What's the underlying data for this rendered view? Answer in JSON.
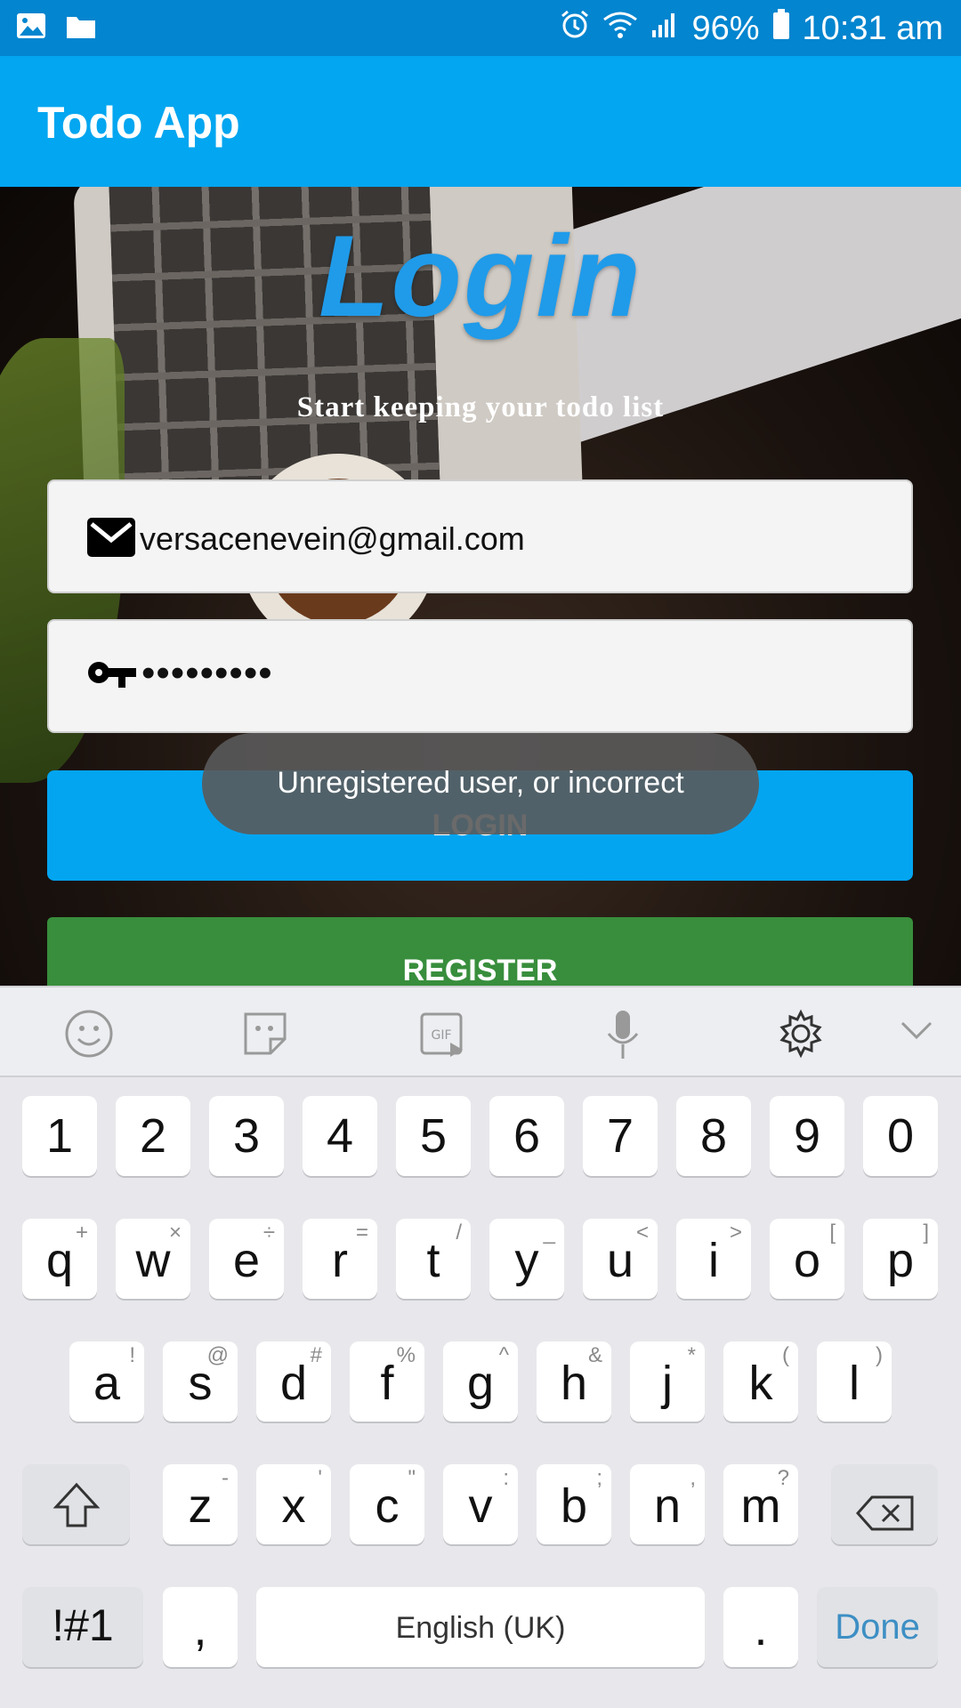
{
  "status_bar": {
    "battery": "96%",
    "time": "10:31 am"
  },
  "app_bar": {
    "title": "Todo App"
  },
  "login": {
    "heading": "Login",
    "subtitle": "Start keeping your todo list",
    "email_value": "versacenevein@gmail.com",
    "password_mask": "•••••••••",
    "login_button": "LOGIN",
    "register_button": "REGISTER"
  },
  "toast": {
    "message": "Unregistered user, or incorrect"
  },
  "keyboard": {
    "number_row": [
      "1",
      "2",
      "3",
      "4",
      "5",
      "6",
      "7",
      "8",
      "9",
      "0"
    ],
    "row1": [
      {
        "k": "q",
        "alt": "+"
      },
      {
        "k": "w",
        "alt": "×"
      },
      {
        "k": "e",
        "alt": "÷"
      },
      {
        "k": "r",
        "alt": "="
      },
      {
        "k": "t",
        "alt": "/"
      },
      {
        "k": "y",
        "alt": "_"
      },
      {
        "k": "u",
        "alt": "<"
      },
      {
        "k": "i",
        "alt": ">"
      },
      {
        "k": "o",
        "alt": "["
      },
      {
        "k": "p",
        "alt": "]"
      }
    ],
    "row2": [
      {
        "k": "a",
        "alt": "!"
      },
      {
        "k": "s",
        "alt": "@"
      },
      {
        "k": "d",
        "alt": "#"
      },
      {
        "k": "f",
        "alt": "%"
      },
      {
        "k": "g",
        "alt": "^"
      },
      {
        "k": "h",
        "alt": "&"
      },
      {
        "k": "j",
        "alt": "*"
      },
      {
        "k": "k",
        "alt": "("
      },
      {
        "k": "l",
        "alt": ")"
      }
    ],
    "row3": [
      {
        "k": "z",
        "alt": "-"
      },
      {
        "k": "x",
        "alt": "'"
      },
      {
        "k": "c",
        "alt": "\""
      },
      {
        "k": "v",
        "alt": ":"
      },
      {
        "k": "b",
        "alt": ";"
      },
      {
        "k": "n",
        "alt": ","
      },
      {
        "k": "m",
        "alt": "?"
      }
    ],
    "symbols_key": "!#1",
    "comma_key": ",",
    "space_label": "English (UK)",
    "period_key": ".",
    "done_key": "Done"
  }
}
